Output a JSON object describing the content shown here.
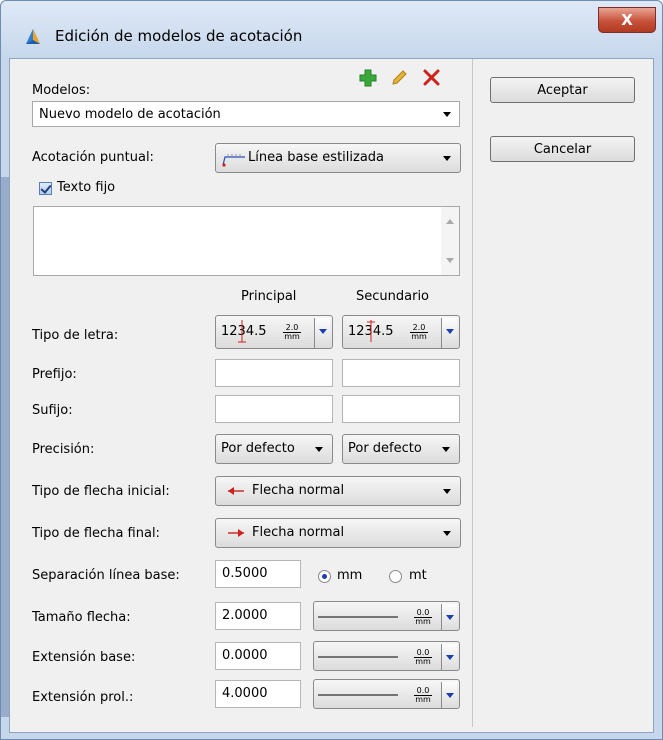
{
  "window": {
    "title": "Edición de modelos de acotación",
    "close_glyph": "X"
  },
  "modelos": {
    "label": "Modelos:",
    "selected": "Nuevo modelo de acotación"
  },
  "acotacion": {
    "label": "Acotación puntual:",
    "selected": "Línea base estilizada"
  },
  "texto_fijo": {
    "label": "Texto fijo",
    "checked": true
  },
  "columns": {
    "principal": "Principal",
    "secundario": "Secundario"
  },
  "font": {
    "label": "Tipo de letra:",
    "principal": {
      "sample": "1234.5",
      "size": "2.0",
      "unit": "mm"
    },
    "secundario": {
      "sample": "1234.5",
      "size": "2.0",
      "unit": "mm"
    }
  },
  "prefijo": {
    "label": "Prefijo:",
    "principal": "",
    "secundario": ""
  },
  "sufijo": {
    "label": "Sufijo:",
    "principal": "",
    "secundario": ""
  },
  "precision": {
    "label": "Precisión:",
    "principal": "Por defecto",
    "secundario": "Por defecto"
  },
  "flecha_inicial": {
    "label": "Tipo de flecha inicial:",
    "selected": "Flecha normal"
  },
  "flecha_final": {
    "label": "Tipo de flecha final:",
    "selected": "Flecha normal"
  },
  "separacion": {
    "label": "Separación línea base:",
    "value": "0.5000",
    "unit_mm": "mm",
    "unit_mt": "mt",
    "selected_unit": "mm"
  },
  "tamano": {
    "label": "Tamaño flecha:",
    "value": "2.0000",
    "line_value": "0.0",
    "line_unit": "mm"
  },
  "ext_base": {
    "label": "Extensión base:",
    "value": "0.0000",
    "line_value": "0.0",
    "line_unit": "mm"
  },
  "ext_prol": {
    "label": "Extensión prol.:",
    "value": "4.0000",
    "line_value": "0.0",
    "line_unit": "mm"
  },
  "buttons": {
    "aceptar": "Aceptar",
    "cancelar": "Cancelar"
  },
  "icons": [
    "app-icon",
    "add-icon",
    "edit-icon",
    "delete-icon",
    "close-icon"
  ],
  "colors": {
    "accent_red": "#d0201a",
    "add_green": "#3aa83a",
    "edit_gold": "#d8a417"
  }
}
